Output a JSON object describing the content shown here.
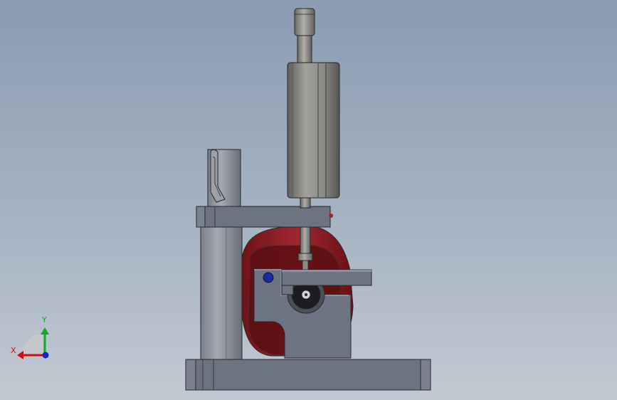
{
  "triad": {
    "x_label": "X",
    "y_label": "Y",
    "x_color": "#cc1111",
    "y_color": "#11aa22",
    "z_color": "#1a22cc"
  },
  "colors": {
    "steel": "#6e7382",
    "steel_light": "#8a8f9c",
    "gauge_body": "#7d7c79",
    "red_part": "#8f1c22",
    "edge": "#2a2a2e"
  }
}
